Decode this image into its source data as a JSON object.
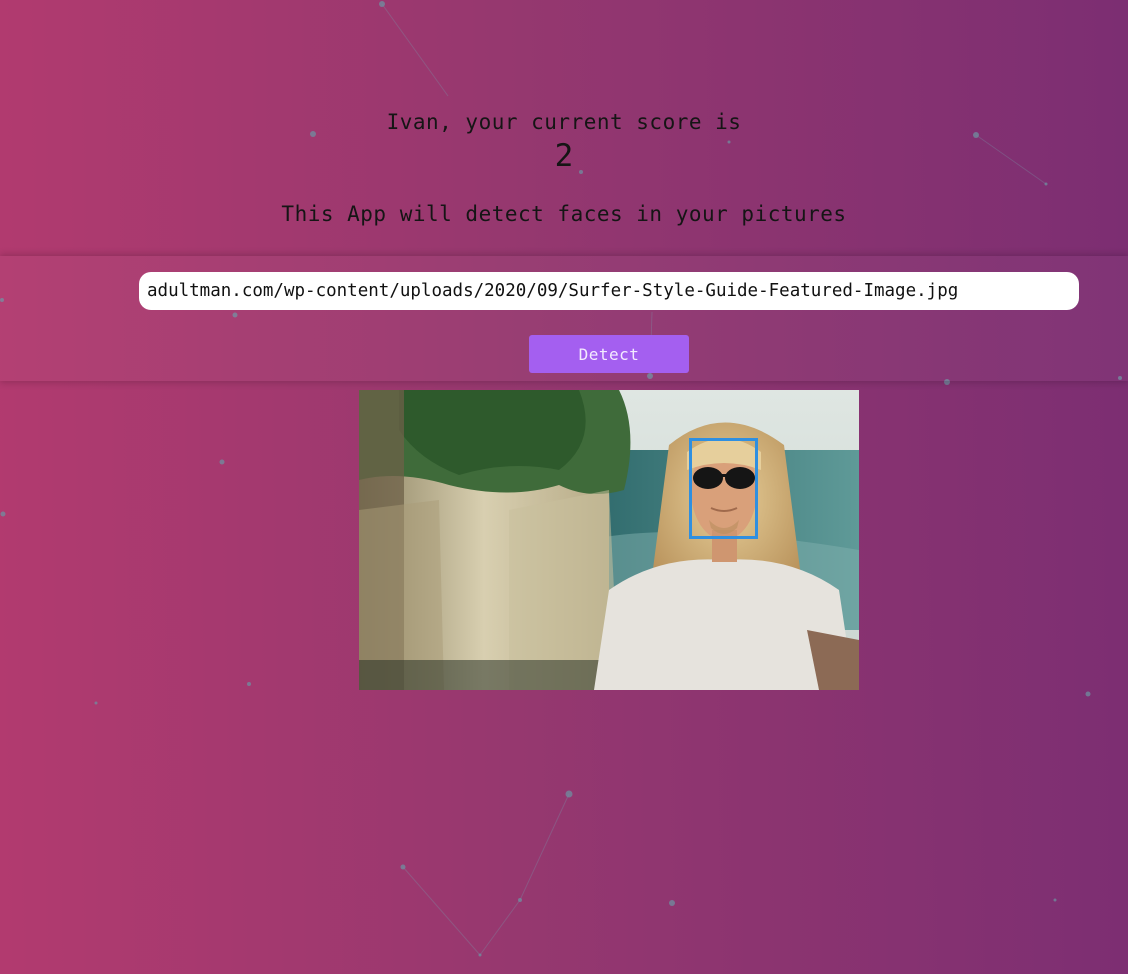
{
  "user": {
    "score_label": "Ivan, your current score is",
    "score": "2"
  },
  "tagline": "This App will detect faces in your pictures",
  "form": {
    "url_value": "adultman.com/wp-content/uploads/2020/09/Surfer-Style-Guide-Featured-Image.jpg",
    "detect_label": "Detect"
  },
  "image": {
    "description_icon": "surfer-photo",
    "faces_detected": 1
  },
  "colors": {
    "background_start": "#b23a6f",
    "background_end": "#7c2e72",
    "button": "#a45ff0",
    "face_box": "#2f8fe0",
    "particles": "#6f8fa0"
  }
}
